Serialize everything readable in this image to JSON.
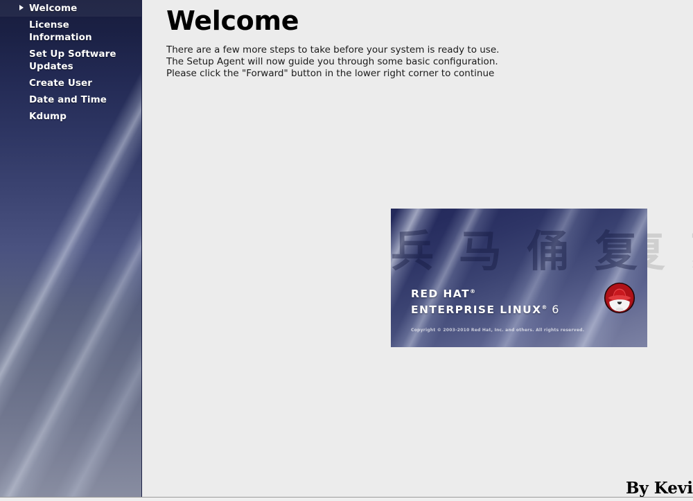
{
  "sidebar": {
    "items": [
      {
        "label": "Welcome",
        "selected": true
      },
      {
        "label": "License\nInformation",
        "selected": false
      },
      {
        "label": "Set Up Software\nUpdates",
        "selected": false
      },
      {
        "label": "Create User",
        "selected": false
      },
      {
        "label": "Date and Time",
        "selected": false
      },
      {
        "label": "Kdump",
        "selected": false
      }
    ],
    "background_top_color": "#171c3d",
    "background_bottom_color": "#888da1"
  },
  "main": {
    "title": "Welcome",
    "body_text": "There are a few more steps to take before your system is ready to use.\nThe Setup Agent will now guide you through some basic configuration.\nPlease click the \"Forward\" button in the lower right corner to continue",
    "background_color": "#ececec"
  },
  "watermark": {
    "text": "兵马俑复苏",
    "color": "#cfcfcf"
  },
  "banner": {
    "brand_line1": "RED HAT",
    "brand_line1_mark": "®",
    "brand_line2": "ENTERPRISE LINUX",
    "brand_line2_mark": "®",
    "version": "6",
    "copyright": "Copyright © 2003-2010 Red Hat, Inc. and others. All rights reserved.",
    "logo_name": "red-hat-shadowman-logo",
    "logo_color": "#cc0000",
    "background_color": "#3b4372"
  },
  "signature": {
    "text": "By Kevi"
  }
}
